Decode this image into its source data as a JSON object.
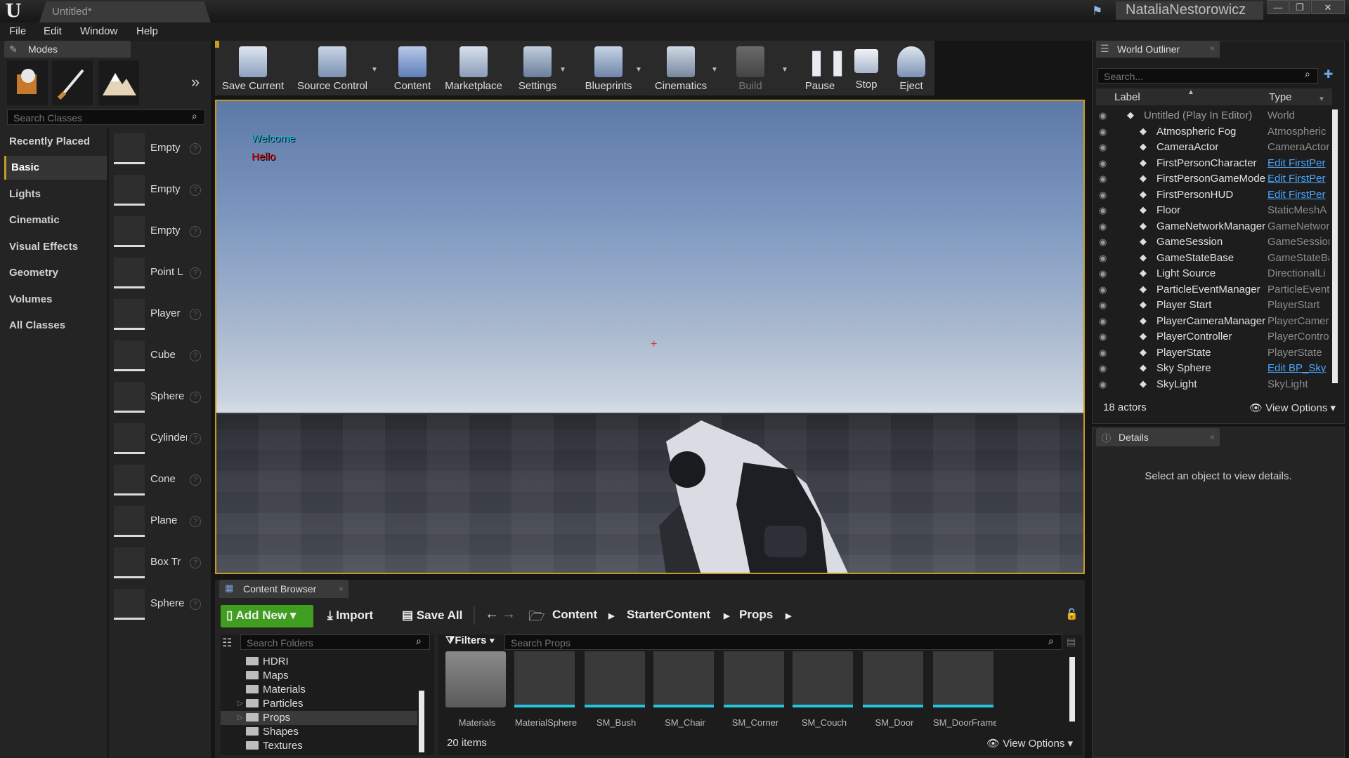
{
  "app": {
    "tab_title": "Untitled*",
    "user": "NataliaNestorowicz"
  },
  "menu": [
    "File",
    "Edit",
    "Window",
    "Help"
  ],
  "modes": {
    "tab_label": "Modes",
    "search_placeholder": "Search Classes",
    "categories": [
      "Recently Placed",
      "Basic",
      "Lights",
      "Cinematic",
      "Visual Effects",
      "Geometry",
      "Volumes",
      "All Classes"
    ],
    "selected_category": "Basic",
    "items": [
      "Empty",
      "Empty",
      "Empty",
      "Point L",
      "Player",
      "Cube",
      "Sphere",
      "Cylinder",
      "Cone",
      "Plane",
      "Box Tr",
      "Sphere"
    ]
  },
  "toolbar": [
    "Save Current",
    "Source Control",
    "Content",
    "Marketplace",
    "Settings",
    "Blueprints",
    "Cinematics",
    "Build",
    "Pause",
    "Stop",
    "Eject"
  ],
  "viewport": {
    "welcome": "Welcome",
    "hello": "Hello"
  },
  "outliner": {
    "tab_label": "World Outliner",
    "search_placeholder": "Search...",
    "col_label": "Label",
    "col_type": "Type",
    "rows": [
      {
        "label": "Untitled (Play In Editor)",
        "type": "World",
        "link": false,
        "icon": "world-icon"
      },
      {
        "label": "Atmospheric Fog",
        "type": "Atmospheric",
        "link": false,
        "icon": "fog-icon"
      },
      {
        "label": "CameraActor",
        "type": "CameraActor",
        "link": false,
        "icon": "camera-icon"
      },
      {
        "label": "FirstPersonCharacter",
        "type": "Edit FirstPer",
        "link": true,
        "icon": "character-icon"
      },
      {
        "label": "FirstPersonGameMode",
        "type": "Edit FirstPer",
        "link": true,
        "icon": "gamemode-icon"
      },
      {
        "label": "FirstPersonHUD",
        "type": "Edit FirstPer",
        "link": true,
        "icon": "hud-icon"
      },
      {
        "label": "Floor",
        "type": "StaticMeshA",
        "link": false,
        "icon": "mesh-icon"
      },
      {
        "label": "GameNetworkManager",
        "type": "GameNetwor",
        "link": false,
        "icon": "actor-icon"
      },
      {
        "label": "GameSession",
        "type": "GameSession",
        "link": false,
        "icon": "actor-icon"
      },
      {
        "label": "GameStateBase",
        "type": "GameStateBa",
        "link": false,
        "icon": "gamestate-icon"
      },
      {
        "label": "Light Source",
        "type": "DirectionalLi",
        "link": false,
        "icon": "light-icon"
      },
      {
        "label": "ParticleEventManager",
        "type": "ParticleEvent",
        "link": false,
        "icon": "actor-icon"
      },
      {
        "label": "Player Start",
        "type": "PlayerStart",
        "link": false,
        "icon": "playerstart-icon"
      },
      {
        "label": "PlayerCameraManager",
        "type": "PlayerCamer",
        "link": false,
        "icon": "actor-icon"
      },
      {
        "label": "PlayerController",
        "type": "PlayerContro",
        "link": false,
        "icon": "controller-icon"
      },
      {
        "label": "PlayerState",
        "type": "PlayerState",
        "link": false,
        "icon": "actor-icon"
      },
      {
        "label": "Sky Sphere",
        "type": "Edit BP_Sky",
        "link": true,
        "icon": "actor-icon"
      },
      {
        "label": "SkyLight",
        "type": "SkyLight",
        "link": false,
        "icon": "skylight-icon"
      }
    ],
    "count": "18 actors",
    "view_options": "View Options"
  },
  "details": {
    "tab_label": "Details",
    "empty_text": "Select an object to view details."
  },
  "content_browser": {
    "tab_label": "Content Browser",
    "add_new": "Add New",
    "import": "Import",
    "save_all": "Save All",
    "breadcrumbs": [
      "Content",
      "StarterContent",
      "Props"
    ],
    "folder_search": "Search Folders",
    "filters": "Filters",
    "asset_search": "Search Props",
    "folders": [
      "HDRI",
      "Maps",
      "Materials",
      "Particles",
      "Props",
      "Shapes",
      "Textures"
    ],
    "selected_folder": "Props",
    "assets": [
      "Materials",
      "MaterialSphere",
      "SM_Bush",
      "SM_Chair",
      "SM_Corner",
      "SM_Couch",
      "SM_Door",
      "SM_DoorFrame"
    ],
    "item_count": "20 items",
    "view_options": "View Options"
  },
  "colors": {
    "accent": "#c79a26",
    "link": "#4aa7ff",
    "asset_bar": "#22c5dc",
    "add_new": "#3f9d1f"
  }
}
